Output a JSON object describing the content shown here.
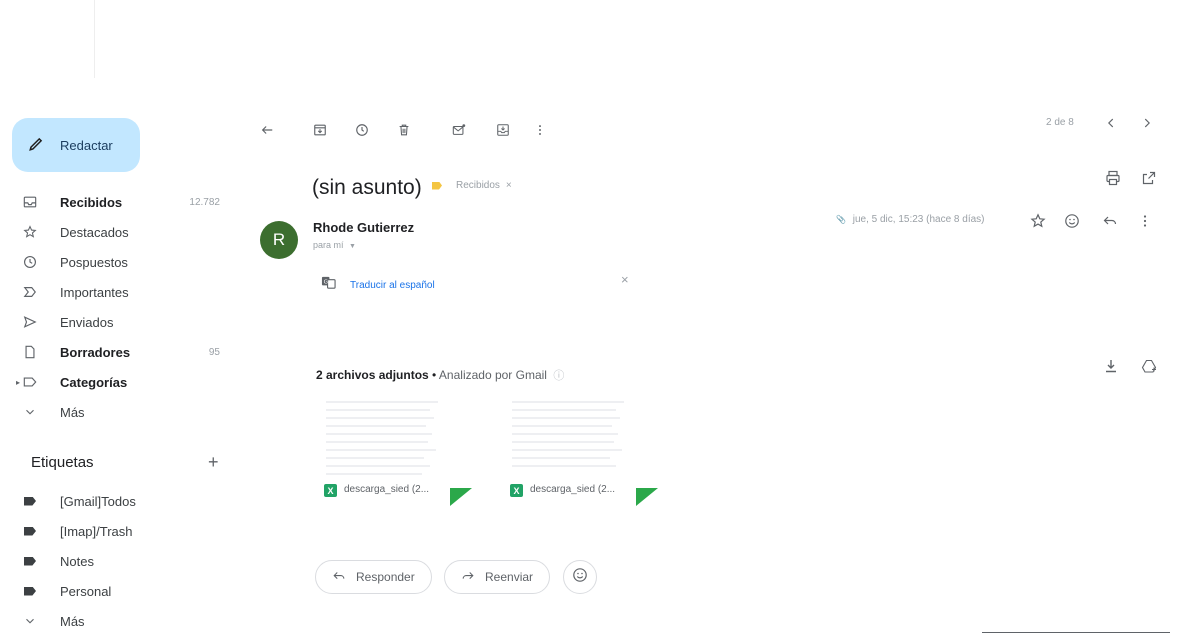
{
  "sidebar": {
    "compose_label": "Redactar",
    "items": [
      {
        "label": "Recibidos",
        "count": "12.782",
        "icon": "inbox-icon"
      },
      {
        "label": "Destacados",
        "count": "",
        "icon": "star-icon"
      },
      {
        "label": "Pospuestos",
        "count": "",
        "icon": "clock-icon"
      },
      {
        "label": "Importantes",
        "count": "",
        "icon": "important-icon"
      },
      {
        "label": "Enviados",
        "count": "",
        "icon": "send-icon"
      },
      {
        "label": "Borradores",
        "count": "95",
        "icon": "draft-icon"
      },
      {
        "label": "Categorías",
        "count": "",
        "icon": "label-outline-icon"
      },
      {
        "label": "Más",
        "count": "",
        "icon": "chevron-down-icon"
      }
    ],
    "labels_heading": "Etiquetas",
    "labels_add": "+",
    "labels": [
      {
        "label": "[Gmail]Todos"
      },
      {
        "label": "[Imap]/Trash"
      },
      {
        "label": "Notes"
      },
      {
        "label": "Personal"
      }
    ],
    "labels_more": "Más"
  },
  "toolbar": {
    "pager": "2 de 8",
    "icons": [
      "back-arrow-icon",
      "archive-icon",
      "snooze-icon",
      "delete-icon",
      "mark-unread-icon",
      "move-to-icon",
      "more-vert-icon"
    ]
  },
  "message": {
    "subject": "(sin asunto)",
    "label_chip": "Recibidos",
    "label_chip_close": "×",
    "sender_initial": "R",
    "sender": "Rhode Gutierrez",
    "recipient": "para mí",
    "date": "jue, 5 dic, 15:23 (hace 8 días)",
    "translate_link": "Traducir al español",
    "translate_close": "×",
    "attachments_count": "2 archivos adjuntos",
    "attachments_separator": " • ",
    "attachments_scan": "Analizado por Gmail",
    "attachments": [
      {
        "name": "descarga_sied (2..."
      },
      {
        "name": "descarga_sied (2..."
      }
    ],
    "xl_badge": "X",
    "reply_label": "Responder",
    "forward_label": "Reenviar"
  },
  "colors": {
    "compose_bg": "#c2e7ff",
    "avatar_bg": "#3c6e2f",
    "link": "#1a73e8",
    "label_yellow": "#f4c542",
    "excel_green": "#21a366"
  }
}
